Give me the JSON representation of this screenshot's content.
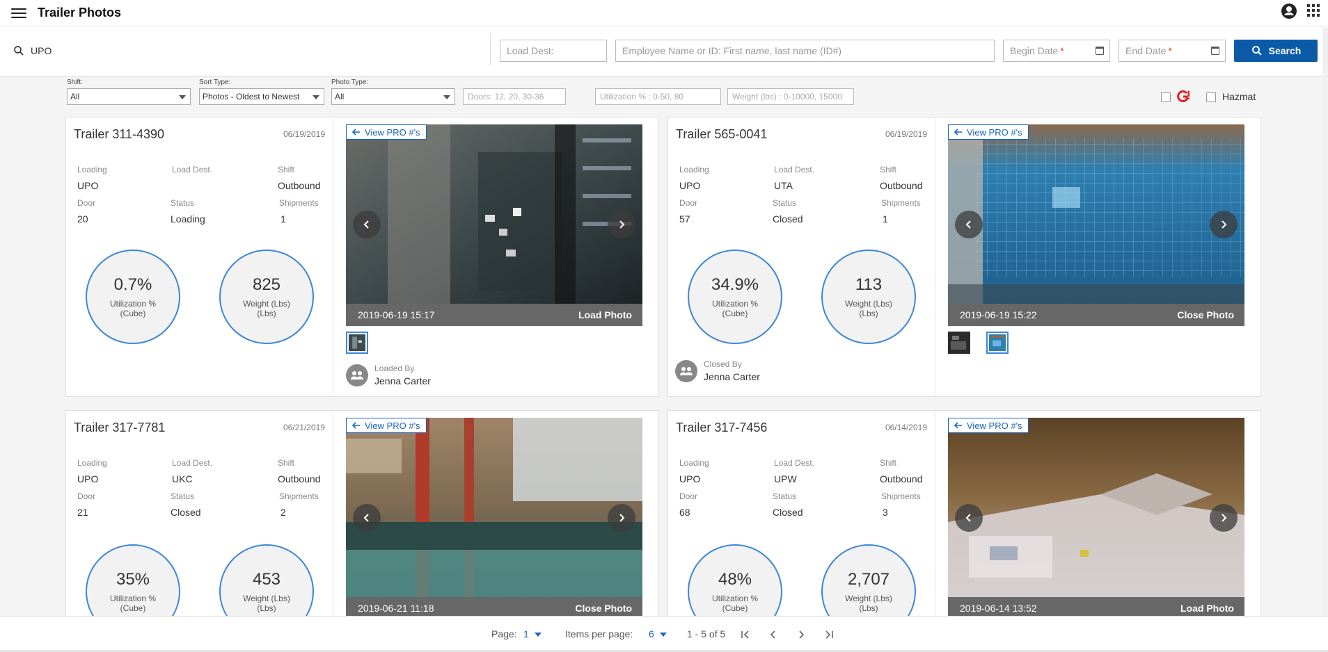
{
  "app": {
    "title": "Trailer Photos"
  },
  "search": {
    "term": "UPO",
    "load_dest_placeholder": "Load Dest:",
    "employee_placeholder": "Employee Name or ID: First name, last name (ID#)",
    "begin_date_placeholder": "Begin Date",
    "end_date_placeholder": "End Date",
    "required_mark": "*",
    "button_label": "Search"
  },
  "filters": {
    "shift_label": "Shift:",
    "shift_value": "All",
    "sort_label": "Sort Type:",
    "sort_value": "Photos - Oldest to Newest",
    "photo_type_label": "Photo Type:",
    "photo_type_value": "All",
    "doors_placeholder": "Doors: 12, 20, 30-36",
    "utilization_placeholder": "Utilization % : 0-50, 80",
    "weight_placeholder": "Weight (lbs) : 0-10000, 15000",
    "hazmat_label": "Hazmat"
  },
  "labels": {
    "loading": "Loading",
    "load_dest": "Load Dest.",
    "shift": "Shift",
    "door": "Door",
    "status": "Status",
    "shipments": "Shipments",
    "utilization": "Utilization %",
    "cube": "(Cube)",
    "weight": "Weight (Lbs)",
    "lbs": "(Lbs)",
    "view_pro": "View PRO #'s",
    "loaded_by": "Loaded By",
    "closed_by": "Closed By"
  },
  "cards": [
    {
      "title": "Trailer 311-4390",
      "date": "06/19/2019",
      "loading": "UPO",
      "load_dest": "",
      "shift": "Outbound",
      "door": "20",
      "status": "Loading",
      "shipments": "1",
      "utilization": "0.7%",
      "weight": "825",
      "photo_timestamp": "2019-06-19 15:17",
      "photo_type": "Load Photo",
      "by_label": "Loaded By",
      "by_name": "Jenna Carter"
    },
    {
      "title": "Trailer 565-0041",
      "date": "06/19/2019",
      "loading": "UPO",
      "load_dest": "UTA",
      "shift": "Outbound",
      "door": "57",
      "status": "Closed",
      "shipments": "1",
      "utilization": "34.9%",
      "weight": "113",
      "photo_timestamp": "2019-06-19 15:22",
      "photo_type": "Close Photo",
      "by_label": "Closed By",
      "by_name": "Jenna Carter"
    },
    {
      "title": "Trailer 317-7781",
      "date": "06/21/2019",
      "loading": "UPO",
      "load_dest": "UKC",
      "shift": "Outbound",
      "door": "21",
      "status": "Closed",
      "shipments": "2",
      "utilization": "35%",
      "weight": "453",
      "photo_timestamp": "2019-06-21 11:18",
      "photo_type": "Close Photo"
    },
    {
      "title": "Trailer 317-7456",
      "date": "06/14/2019",
      "loading": "UPO",
      "load_dest": "UPW",
      "shift": "Outbound",
      "door": "68",
      "status": "Closed",
      "shipments": "3",
      "utilization": "48%",
      "weight": "2,707",
      "photo_timestamp": "2019-06-14 13:52",
      "photo_type": "Load Photo"
    }
  ],
  "pager": {
    "page_label": "Page:",
    "page_value": "1",
    "items_label": "Items per page:",
    "items_value": "6",
    "range": "1 - 5 of 5"
  },
  "colors": {
    "accent": "#0a5aa8",
    "circle_border": "#3c86d8",
    "link": "#1565c0"
  }
}
